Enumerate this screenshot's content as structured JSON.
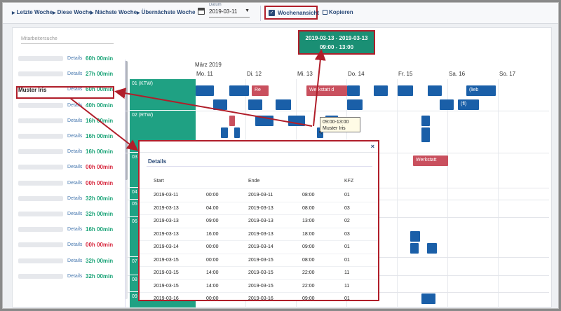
{
  "toolbar": {
    "nav": [
      "Letzte Woche",
      "Diese Woche",
      "Nächste Woche",
      "Übernächste Woche"
    ],
    "date_label": "Datum",
    "date_value": "2019-03-11",
    "week_view_label": "Wochenansicht",
    "week_view_checked": true,
    "copy_label": "Kopieren"
  },
  "search_placeholder": "Mitarbeitersuche",
  "selection": {
    "range": "2019-03-13 - 2019-03-13",
    "time": "09:00 - 13:00"
  },
  "employees": [
    {
      "name": "",
      "details": "Details",
      "hours": "60h 00min",
      "color": "#1aa377"
    },
    {
      "name": "",
      "details": "Details",
      "hours": "27h 00min",
      "color": "#1aa377"
    },
    {
      "name": "Muster Iris",
      "details": "Details",
      "hours": "60h 00min",
      "color": "#1aa377"
    },
    {
      "name": "",
      "details": "Details",
      "hours": "40h 00min",
      "color": "#1aa377"
    },
    {
      "name": "",
      "details": "Details",
      "hours": "16h 00min",
      "color": "#1aa377"
    },
    {
      "name": "",
      "details": "Details",
      "hours": "16h 00min",
      "color": "#1aa377"
    },
    {
      "name": "",
      "details": "Details",
      "hours": "16h 00min",
      "color": "#1aa377"
    },
    {
      "name": "",
      "details": "Details",
      "hours": "00h 00min",
      "color": "#d7263d"
    },
    {
      "name": "",
      "details": "Details",
      "hours": "00h 00min",
      "color": "#d7263d"
    },
    {
      "name": "",
      "details": "Details",
      "hours": "32h 00min",
      "color": "#1aa377"
    },
    {
      "name": "",
      "details": "Details",
      "hours": "32h 00min",
      "color": "#1aa377"
    },
    {
      "name": "",
      "details": "Details",
      "hours": "16h 00min",
      "color": "#1aa377"
    },
    {
      "name": "",
      "details": "Details",
      "hours": "00h 00min",
      "color": "#d7263d"
    },
    {
      "name": "",
      "details": "Details",
      "hours": "32h 00min",
      "color": "#1aa377"
    },
    {
      "name": "",
      "details": "Details",
      "hours": "32h 00min",
      "color": "#1aa377"
    }
  ],
  "calendar": {
    "month": "März 2019",
    "days": [
      "Mo. 11",
      "Di. 12",
      "Mi. 13",
      "Do. 14",
      "Fr. 15",
      "Sa. 16",
      "So. 17"
    ],
    "vehicles": [
      "01 (KTW)",
      "02 (RTW)",
      "03",
      "04",
      "05",
      "06",
      "07",
      "08",
      "09"
    ],
    "event_labels": {
      "re": "Re",
      "werkstatt": "Werkstatt d",
      "werkstatt2": "Werkstatt",
      "lieb": "(lieb",
      "fl": "(fl)"
    }
  },
  "tooltip": {
    "time": "09:00-13:00",
    "name": "Muster Iris"
  },
  "details": {
    "title": "Details",
    "close": "×",
    "headers": [
      "Start",
      "Ende",
      "KFZ"
    ],
    "rows": [
      [
        "2019-03-11",
        "00:00",
        "2019-03-11",
        "08:00",
        "01"
      ],
      [
        "2019-03-13",
        "04:00",
        "2019-03-13",
        "08:00",
        "03"
      ],
      [
        "2019-03-13",
        "09:00",
        "2019-03-13",
        "13:00",
        "02"
      ],
      [
        "2019-03-13",
        "16:00",
        "2019-03-13",
        "18:00",
        "03"
      ],
      [
        "2019-03-14",
        "00:00",
        "2019-03-14",
        "09:00",
        "01"
      ],
      [
        "2019-03-15",
        "00:00",
        "2019-03-15",
        "08:00",
        "01"
      ],
      [
        "2019-03-15",
        "14:00",
        "2019-03-15",
        "22:00",
        "11"
      ],
      [
        "2019-03-15",
        "14:00",
        "2019-03-15",
        "22:00",
        "11"
      ],
      [
        "2019-03-16",
        "00:00",
        "2019-03-16",
        "09:00",
        "01"
      ]
    ]
  },
  "colors": {
    "accent_green": "#1a8f74",
    "event_blue": "#1a5fa8",
    "event_red": "#c9505e",
    "highlight": "#b01e2a"
  }
}
